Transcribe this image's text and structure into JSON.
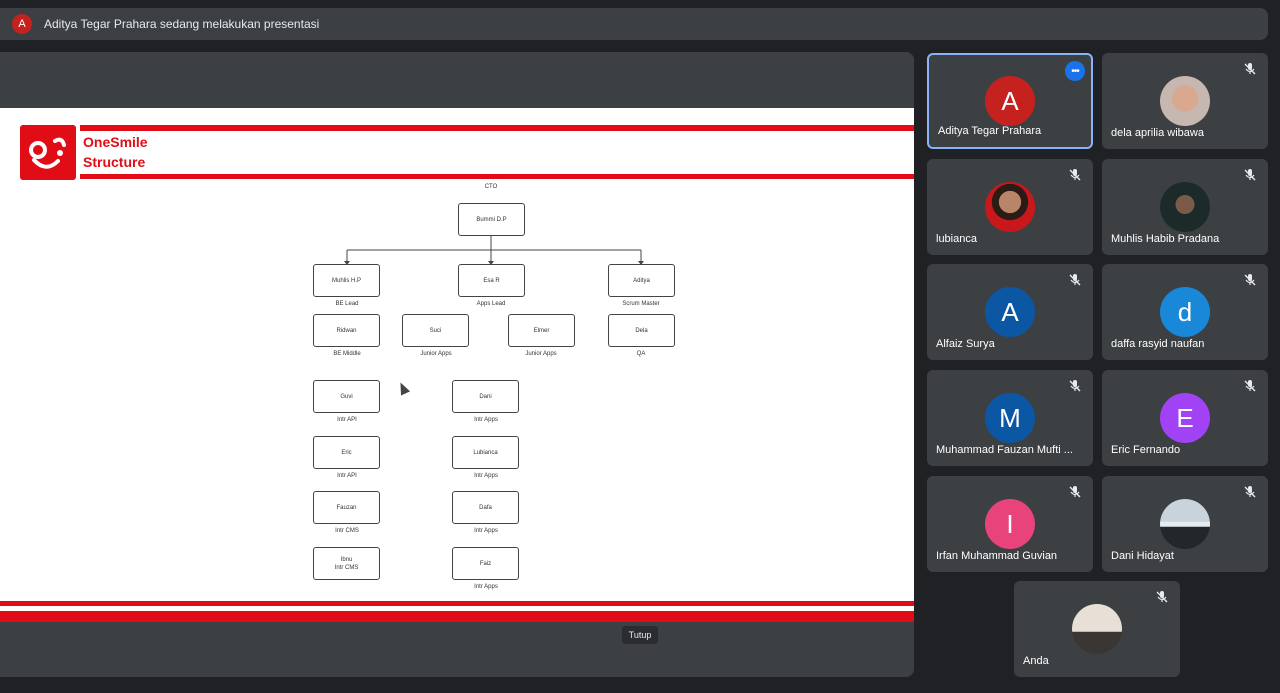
{
  "presenter": {
    "initial": "A",
    "banner": "Aditya Tegar Prahara sedang melakukan presentasi"
  },
  "slide": {
    "brand_line1": "OneSmile",
    "brand_line2": "Structure",
    "cto_label": "CTO",
    "org": {
      "cto": "Bummi D.P",
      "leads": [
        {
          "name": "Muhlis H.P",
          "role": "BE Lead"
        },
        {
          "name": "Esa R",
          "role": "Apps Lead"
        },
        {
          "name": "Aditya",
          "role": "Scrum Master"
        }
      ],
      "row2": [
        {
          "name": "Ridwan",
          "role": "BE Middle"
        },
        {
          "name": "Suci",
          "role": "Junior Apps"
        },
        {
          "name": "Elmer",
          "role": "Junior Apps"
        },
        {
          "name": "Dela",
          "role": "QA"
        }
      ],
      "left_col": [
        {
          "name": "Guvi",
          "role": "Intr API"
        },
        {
          "name": "Eric",
          "role": "Intr API"
        },
        {
          "name": "Fauzan",
          "role": "Intr CMS"
        },
        {
          "name": "Ibnu",
          "role": "Intr CMS"
        }
      ],
      "right_col": [
        {
          "name": "Dani",
          "role": "Intr Apps"
        },
        {
          "name": "Lubianca",
          "role": "Intr Apps"
        },
        {
          "name": "Dafa",
          "role": "Intr Apps"
        },
        {
          "name": "Faiz",
          "role": "Intr Apps"
        }
      ]
    }
  },
  "close_label": "Tutup",
  "participants": [
    {
      "name": "Aditya Tegar Prahara",
      "initial": "A",
      "color": "#c5221f",
      "active": true
    },
    {
      "name": "dela aprilia wibawa",
      "photo": true
    },
    {
      "name": "lubianca",
      "photo": true
    },
    {
      "name": "Muhlis Habib Pradana",
      "photo": true
    },
    {
      "name": "Alfaiz Surya",
      "initial": "A",
      "color": "#0b57a4"
    },
    {
      "name": "daffa rasyid naufan",
      "initial": "d",
      "color": "#1a88d8"
    },
    {
      "name": "Muhammad Fauzan Mufti ...",
      "initial": "M",
      "color": "#0b57a4"
    },
    {
      "name": "Eric Fernando",
      "initial": "E",
      "color": "#a142f4"
    },
    {
      "name": "Irfan Muhammad Guvian",
      "initial": "I",
      "color": "#e8437a"
    },
    {
      "name": "Dani Hidayat",
      "photo": true
    },
    {
      "name": "Anda",
      "photo": true
    }
  ],
  "more_icon": "more-horiz-icon",
  "mic_icon": "mic-off-icon"
}
